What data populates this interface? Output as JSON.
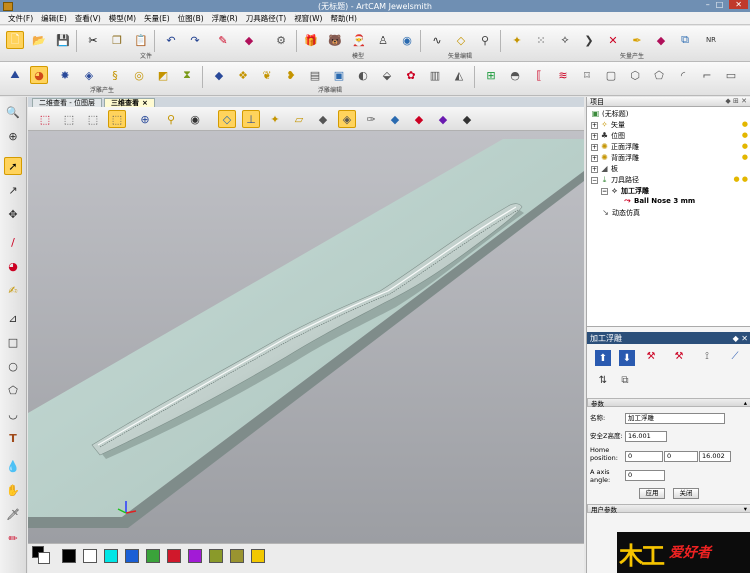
{
  "window": {
    "title": "(无标题) - ArtCAM Jewelsmith",
    "minimize": "–",
    "maximize": "□",
    "close": "✕"
  },
  "menu": [
    "文件(F)",
    "编辑(E)",
    "查看(V)",
    "模型(M)",
    "矢量(E)",
    "位图(B)",
    "浮雕(R)",
    "刀具路径(T)",
    "视窗(W)",
    "帮助(H)"
  ],
  "toolbar": {
    "groups": [
      "文件",
      "模型",
      "矢量编辑",
      "矢量产生",
      "浮雕产生",
      "浮雕编辑"
    ]
  },
  "view_tabs": [
    {
      "label": "二维查看 - 位图层",
      "active": false
    },
    {
      "label": "三维查看",
      "active": true
    }
  ],
  "palette": {
    "colors": [
      "#000000",
      "#ffffff",
      "#00e6e6",
      "#1a5fd6",
      "#3aa33a",
      "#d0182b",
      "#a21bd6",
      "#8a9a2a",
      "#9a9430",
      "#f2c800"
    ]
  },
  "project_panel": {
    "title": "项目",
    "tree": [
      {
        "label": "(无标题)",
        "level": 0
      },
      {
        "label": "矢量",
        "level": 1
      },
      {
        "label": "位图",
        "level": 1
      },
      {
        "label": "正面浮雕",
        "level": 1
      },
      {
        "label": "背面浮雕",
        "level": 1
      },
      {
        "label": "板",
        "level": 1
      },
      {
        "label": "刀具路径",
        "level": 1
      },
      {
        "label": "加工浮雕",
        "level": 2
      },
      {
        "label": "Ball Nose 3 mm",
        "level": 3
      },
      {
        "label": "动态仿真",
        "level": 1
      }
    ]
  },
  "machining_panel": {
    "title": "加工浮雕",
    "params_section": "参数",
    "name_label": "名称:",
    "name_value": "加工浮雕",
    "safe_z_label": "安全Z高度:",
    "safe_z_value": "16.001",
    "home_label": "Home position:",
    "home_x": "0",
    "home_y": "0",
    "home_z": "16.002",
    "a_axis_label": "A axis angle:",
    "a_axis_value": "0",
    "apply_label": "应用",
    "close_label": "关闭",
    "user_section": "用户参数"
  },
  "logo_text": {
    "yellow": "木工",
    "red": "爱好者"
  }
}
